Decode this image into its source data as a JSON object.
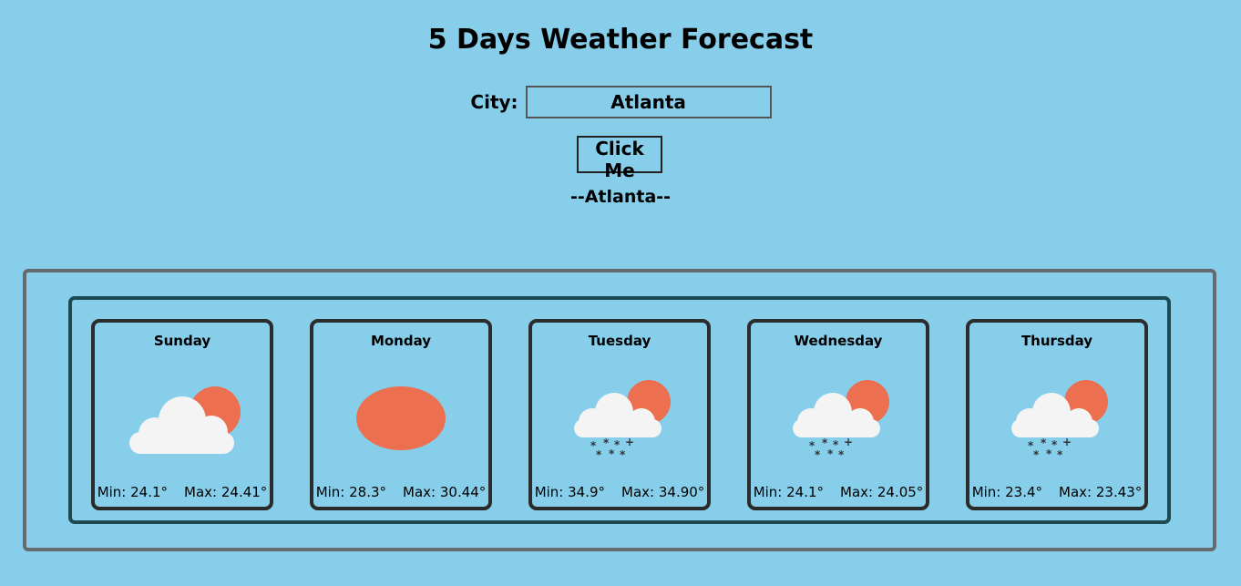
{
  "header": {
    "title": "5 Days Weather Forecast"
  },
  "search": {
    "label": "City:",
    "value": "Atlanta",
    "button_label": "Click Me"
  },
  "result": {
    "city_heading": "--Atlanta--"
  },
  "forecast": [
    {
      "day": "Sunday",
      "icon": "partly-cloudy-icon",
      "min": "Min: 24.1°",
      "max": "Max: 24.41°"
    },
    {
      "day": "Monday",
      "icon": "sun-icon",
      "min": "Min: 28.3°",
      "max": "Max: 30.44°"
    },
    {
      "day": "Tuesday",
      "icon": "snow-cloud-sun-icon",
      "min": "Min: 34.9°",
      "max": "Max: 34.90°"
    },
    {
      "day": "Wednesday",
      "icon": "snow-cloud-sun-icon",
      "min": "Min: 24.1°",
      "max": "Max: 24.05°"
    },
    {
      "day": "Thursday",
      "icon": "snow-cloud-sun-icon",
      "min": "Min: 23.4°",
      "max": "Max: 23.43°"
    }
  ],
  "colors": {
    "background": "#87ceeb",
    "sun": "#ec6f4f",
    "cloud": "#f4f4f4",
    "snowflake": "#333333",
    "card_border": "#2b2b2b",
    "inner_border": "#1d4a50",
    "outer_border": "#666a6e"
  }
}
